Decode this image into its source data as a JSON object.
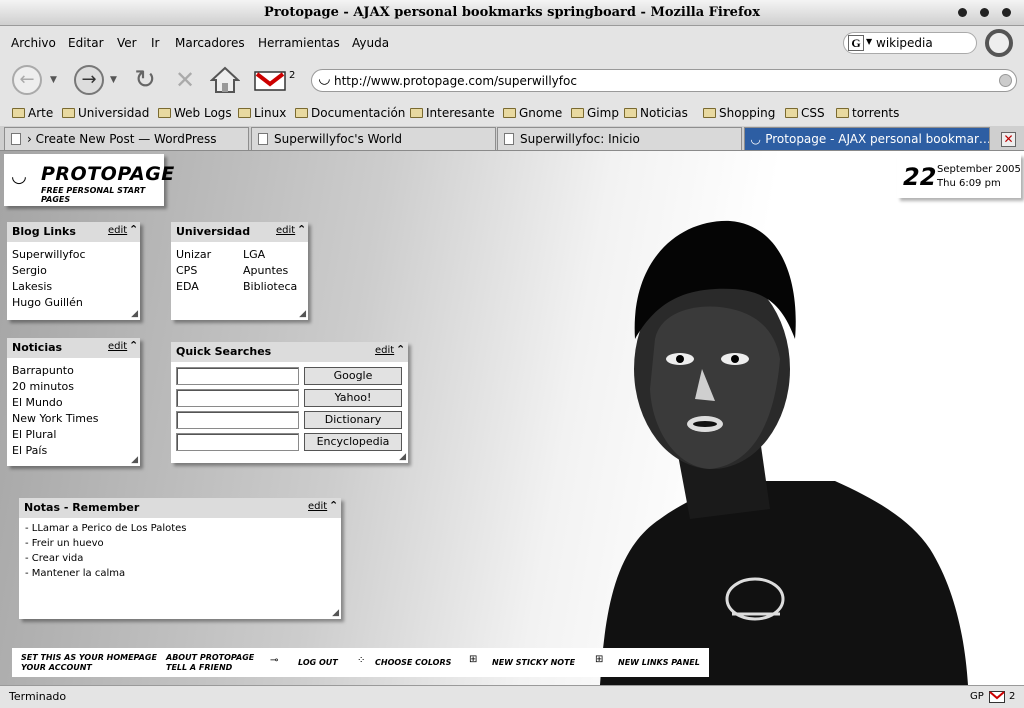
{
  "window": {
    "title": "Protopage - AJAX personal bookmarks springboard - Mozilla Firefox"
  },
  "menu": [
    "Archivo",
    "Editar",
    "Ver",
    "Ir",
    "Marcadores",
    "Herramientas",
    "Ayuda"
  ],
  "search": {
    "value": "wikipedia",
    "engine_icon": "google-icon"
  },
  "nav": {
    "gmail_count": "2",
    "url": "http://www.protopage.com/superwillyfoc"
  },
  "bookmarks": [
    "Arte",
    "Universidad",
    "Web Logs",
    "Linux",
    "Documentación",
    "Interesante",
    "Gnome",
    "Gimp",
    "Noticias",
    "Shopping",
    "CSS",
    "torrents"
  ],
  "tabs": [
    {
      "label": "› Create New Post — WordPress"
    },
    {
      "label": "Superwillyfoc's World"
    },
    {
      "label": "Superwillyfoc: Inicio"
    },
    {
      "label": "Protopage - AJAX personal bookmar…"
    }
  ],
  "logo": {
    "name": "PROTOPAGE",
    "tagline": "FREE PERSONAL START PAGES"
  },
  "date": {
    "day": "22",
    "month_year": "September 2005",
    "time": "Thu 6:09 pm"
  },
  "panels": {
    "edit_label": "edit",
    "blog_links": {
      "title": "Blog Links",
      "links": [
        "Superwillyfoc",
        "Sergio",
        "Lakesis",
        "Hugo Guillén"
      ]
    },
    "universidad": {
      "title": "Universidad",
      "links": [
        "Unizar",
        "LGA",
        "CPS",
        "Apuntes",
        "EDA",
        "Biblioteca"
      ]
    },
    "noticias": {
      "title": "Noticias",
      "links": [
        "Barrapunto",
        "20 minutos",
        "El Mundo",
        "New York Times",
        "El Plural",
        "El País"
      ]
    },
    "quick_searches": {
      "title": "Quick Searches",
      "buttons": [
        "Google",
        "Yahoo!",
        "Dictionary",
        "Encyclopedia"
      ]
    },
    "notas": {
      "title": "Notas - Remember",
      "lines": [
        "- LLamar a Perico de Los Palotes",
        "- Freir un huevo",
        "- Crear vida",
        "- Mantener la calma"
      ]
    }
  },
  "bottom_bar": {
    "set_homepage": "SET THIS AS YOUR HOMEPAGE",
    "your_account": "YOUR ACCOUNT",
    "about": "ABOUT PROTOPAGE",
    "tell_friend": "TELL A FRIEND",
    "log_out": "LOG OUT",
    "choose_colors": "CHOOSE COLORS",
    "new_sticky": "NEW STICKY NOTE",
    "new_links": "NEW LINKS PANEL"
  },
  "status": {
    "text": "Terminado",
    "gp": "GP",
    "count": "2"
  },
  "colors": {
    "active_tab": "#2d5ea3",
    "panel_header": "#dcdcdc"
  }
}
